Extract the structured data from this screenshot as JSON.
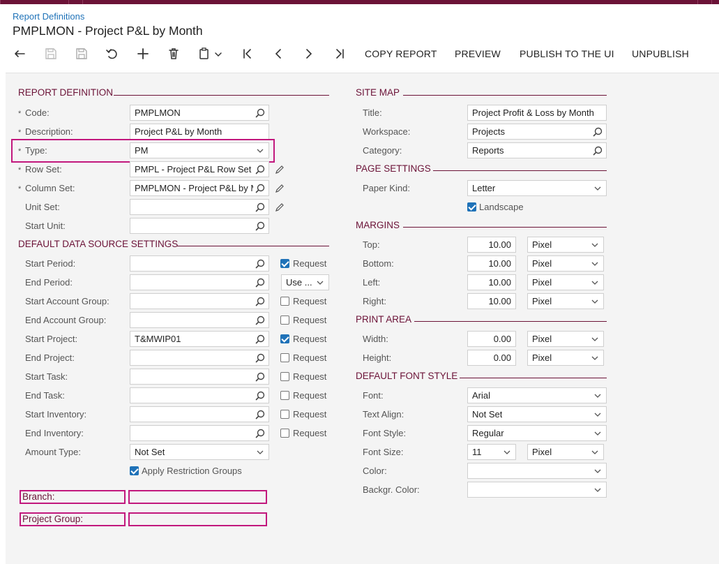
{
  "breadcrumb": "Report Definitions",
  "title": "PMPLMON - Project P&L by Month",
  "toolbar": {
    "icons": [
      "undo-arrow-icon",
      "save-icon",
      "save-close-icon",
      "revert-icon",
      "add-icon",
      "delete-icon",
      "clipboard-icon",
      "chevron-down-icon",
      "first-record-icon",
      "prev-record-icon",
      "next-record-icon",
      "last-record-icon"
    ],
    "copy_report": "COPY REPORT",
    "preview": "PREVIEW",
    "publish": "PUBLISH TO THE UI",
    "unpublish": "UNPUBLISH"
  },
  "report_definition": {
    "header": "REPORT DEFINITION",
    "code": {
      "label": "Code:",
      "value": "PMPLMON"
    },
    "description": {
      "label": "Description:",
      "value": "Project P&L by Month"
    },
    "type": {
      "label": "Type:",
      "value": "PM"
    },
    "row_set": {
      "label": "Row Set:",
      "value": "PMPL - Project P&L Row Set"
    },
    "column_set": {
      "label": "Column Set:",
      "value": "PMPLMON - Project P&L by M"
    },
    "unit_set": {
      "label": "Unit Set:",
      "value": ""
    },
    "start_unit": {
      "label": "Start Unit:",
      "value": ""
    }
  },
  "default_data_source": {
    "header": "DEFAULT DATA SOURCE SETTINGS",
    "request_label": "Request",
    "start_period": {
      "label": "Start Period:",
      "value": "",
      "request": true
    },
    "end_period": {
      "label": "End Period:",
      "value": "",
      "use": "Use ..."
    },
    "start_account_group": {
      "label": "Start Account Group:",
      "value": "",
      "request": false
    },
    "end_account_group": {
      "label": "End Account Group:",
      "value": "",
      "request": false
    },
    "start_project": {
      "label": "Start Project:",
      "value": "T&MWIP01",
      "request": true
    },
    "end_project": {
      "label": "End Project:",
      "value": "",
      "request": false
    },
    "start_task": {
      "label": "Start Task:",
      "value": "",
      "request": false
    },
    "end_task": {
      "label": "End Task:",
      "value": "",
      "request": false
    },
    "start_inventory": {
      "label": "Start Inventory:",
      "value": "",
      "request": false
    },
    "end_inventory": {
      "label": "End Inventory:",
      "value": "",
      "request": false
    },
    "amount_type": {
      "label": "Amount Type:",
      "value": "Not Set"
    },
    "apply_restriction": {
      "label": "Apply Restriction Groups",
      "checked": true
    },
    "branch": {
      "label": "Branch:",
      "value": ""
    },
    "project_group": {
      "label": "Project Group:",
      "value": ""
    }
  },
  "site_map": {
    "header": "SITE MAP",
    "title": {
      "label": "Title:",
      "value": "Project Profit & Loss by Month"
    },
    "workspace": {
      "label": "Workspace:",
      "value": "Projects"
    },
    "category": {
      "label": "Category:",
      "value": "Reports"
    }
  },
  "page_settings": {
    "header": "PAGE SETTINGS",
    "paper_kind": {
      "label": "Paper Kind:",
      "value": "Letter"
    },
    "landscape": {
      "label": "Landscape",
      "checked": true
    }
  },
  "margins": {
    "header": "MARGINS",
    "top": {
      "label": "Top:",
      "value": "10.00",
      "unit": "Pixel"
    },
    "bottom": {
      "label": "Bottom:",
      "value": "10.00",
      "unit": "Pixel"
    },
    "left": {
      "label": "Left:",
      "value": "10.00",
      "unit": "Pixel"
    },
    "right": {
      "label": "Right:",
      "value": "10.00",
      "unit": "Pixel"
    }
  },
  "print_area": {
    "header": "PRINT AREA",
    "width": {
      "label": "Width:",
      "value": "0.00",
      "unit": "Pixel"
    },
    "height": {
      "label": "Height:",
      "value": "0.00",
      "unit": "Pixel"
    }
  },
  "default_font_style": {
    "header": "DEFAULT FONT STYLE",
    "font": {
      "label": "Font:",
      "value": "Arial"
    },
    "text_align": {
      "label": "Text Align:",
      "value": "Not Set"
    },
    "font_style": {
      "label": "Font Style:",
      "value": "Regular"
    },
    "font_size": {
      "label": "Font Size:",
      "value": "11",
      "unit": "Pixel"
    },
    "color": {
      "label": "Color:",
      "value": ""
    },
    "backgr_color": {
      "label": "Backgr. Color:",
      "value": ""
    }
  },
  "colors": {
    "accent": "#6b1237",
    "link": "#1f72b8",
    "highlight": "#c2187d",
    "checkbox": "#1f72b8"
  }
}
